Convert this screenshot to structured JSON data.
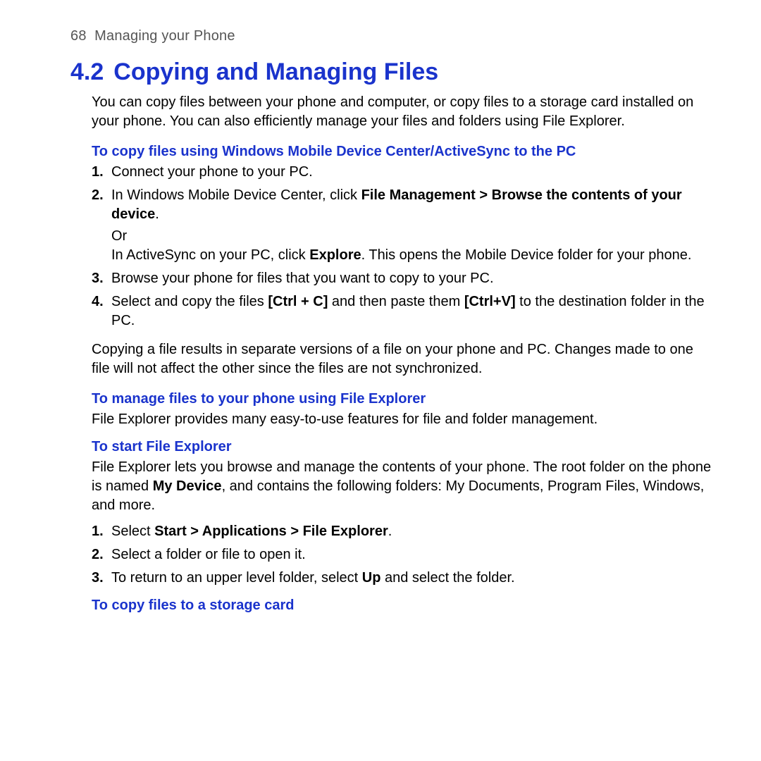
{
  "header": {
    "page_number": "68",
    "chapter": "Managing your Phone"
  },
  "section": {
    "number": "4.2",
    "title": "Copying and Managing Files"
  },
  "intro": "You can copy files between your phone and computer, or copy files to a storage card installed on your phone. You can also efficiently manage your files and folders using File Explorer.",
  "h1": "To copy files using Windows Mobile Device Center/ActiveSync to the PC",
  "steps1": {
    "n1": "1.",
    "s1": "Connect your phone to your PC.",
    "n2": "2.",
    "s2_pre": "In Windows Mobile Device Center, click ",
    "s2_b1": "File Management > Browse the contents of your device",
    "s2_post": ".",
    "s2_or": "Or",
    "s2_line2_pre": "In ActiveSync on your PC, click ",
    "s2_line2_b": "Explore",
    "s2_line2_post": ". This opens the Mobile Device folder for your phone.",
    "n3": "3.",
    "s3": "Browse your phone for files that you want to copy to your PC.",
    "n4": "4.",
    "s4_pre": "Select and copy the files ",
    "s4_b1": "[Ctrl + C]",
    "s4_mid": " and then paste them ",
    "s4_b2": "[Ctrl+V]",
    "s4_post": " to the destination folder in the PC."
  },
  "note1": "Copying a file results in separate versions of a file on your phone and PC. Changes made to one file will not affect the other since the files are not synchronized.",
  "h2": "To manage files to your phone using File Explorer",
  "p2": "File Explorer provides many easy-to-use features for file and folder management.",
  "h3": "To start File Explorer",
  "p3_pre": "File Explorer lets you browse and manage the contents of your phone. The root folder on the phone is named ",
  "p3_b": "My Device",
  "p3_post": ", and contains the following folders: My Documents, Program Files, Windows, and more.",
  "steps2": {
    "n1": "1.",
    "s1_pre": "Select ",
    "s1_b": "Start > Applications > File Explorer",
    "s1_post": ".",
    "n2": "2.",
    "s2": "Select a folder or file to open it.",
    "n3": "3.",
    "s3_pre": "To return to an upper level folder, select ",
    "s3_b": "Up",
    "s3_post": " and select the folder."
  },
  "h4": "To copy files to a storage card"
}
